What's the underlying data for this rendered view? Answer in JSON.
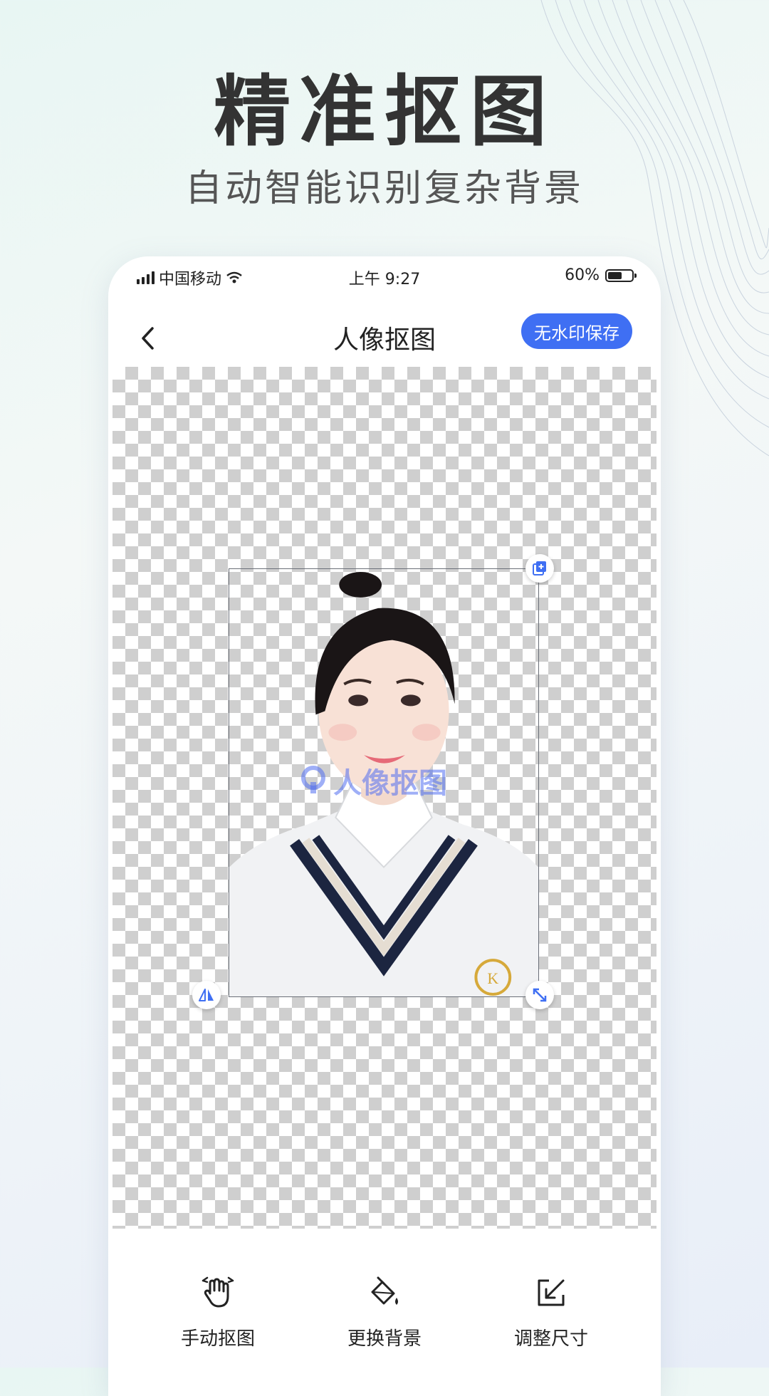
{
  "promo": {
    "headline": "精准抠图",
    "subheadline": "自动智能识别复杂背景"
  },
  "status_bar": {
    "carrier": "中国移动",
    "time": "上午 9:27",
    "battery_percent": "60%",
    "battery_level": 0.6
  },
  "nav": {
    "title": "人像抠图",
    "save_label": "无水印保存"
  },
  "canvas": {
    "watermark": "人像抠图"
  },
  "toolbar": {
    "items": [
      {
        "label": "手动抠图",
        "icon": "hand-gesture-icon"
      },
      {
        "label": "更换背景",
        "icon": "paint-bucket-icon"
      },
      {
        "label": "调整尺寸",
        "icon": "resize-arrow-icon"
      }
    ]
  },
  "colors": {
    "accent": "#3f6ff3",
    "handle_icon": "#3f6ff3"
  }
}
